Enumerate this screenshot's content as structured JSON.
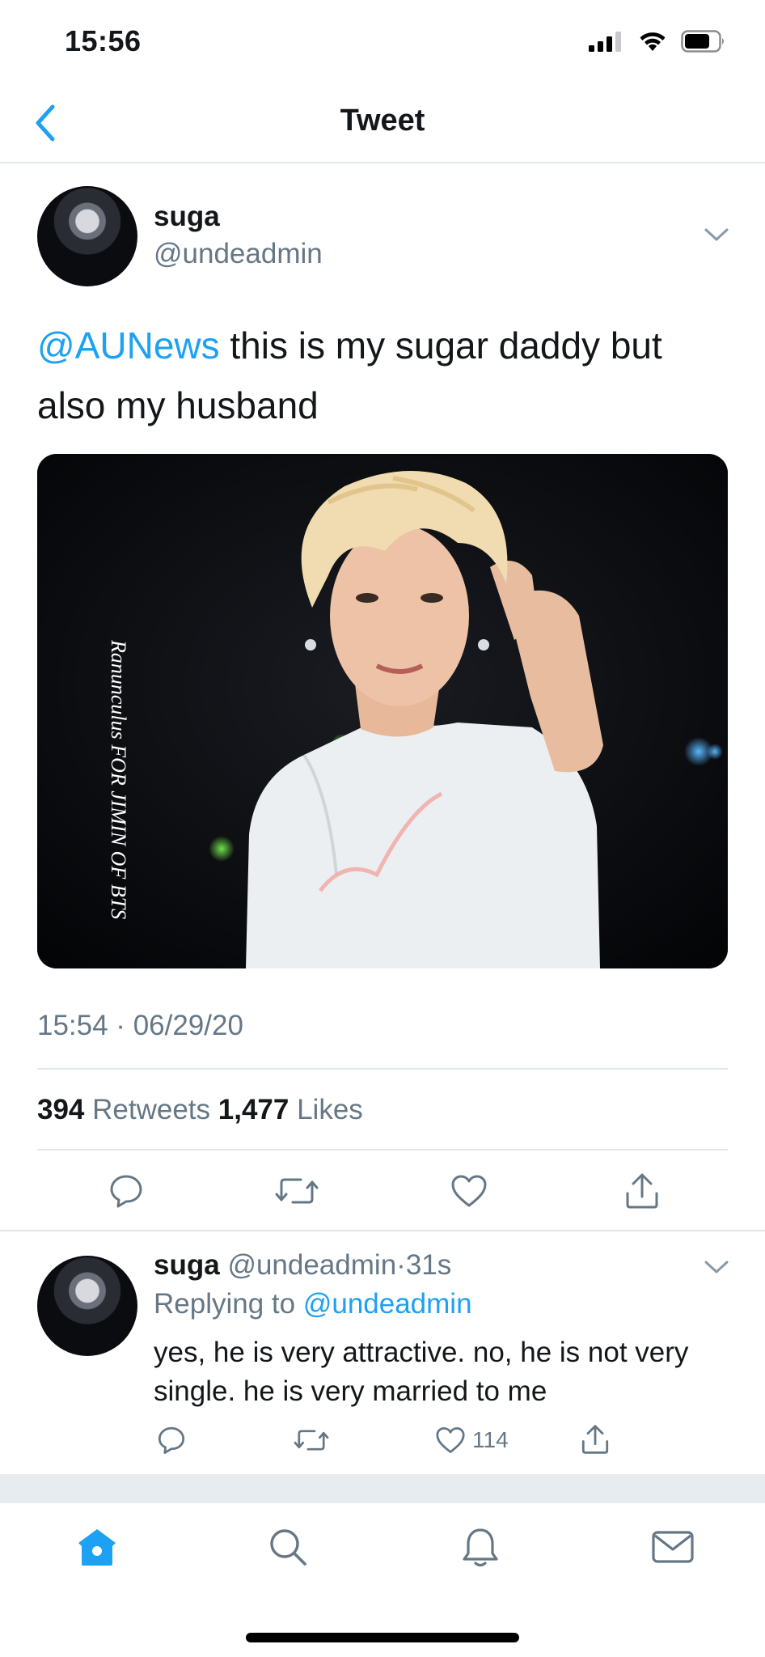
{
  "status_bar": {
    "time": "15:56"
  },
  "nav": {
    "title": "Tweet"
  },
  "tweet": {
    "author_name": "suga",
    "author_handle": "@undeadmin",
    "mention": "@AUNews",
    "text": " this is my sugar daddy but also my husband",
    "image_watermark": "Ranunculus FOR JIMIN OF BTS",
    "timestamp": "15:54 · 06/29/20",
    "retweets_count": "394",
    "retweets_label": " Retweets ",
    "likes_count": "1,477",
    "likes_label": " Likes"
  },
  "reply": {
    "author_name": "suga",
    "author_handle": "@undeadmin",
    "age": "31s",
    "replying_prefix": "Replying to ",
    "replying_to": "@undeadmin",
    "text": "yes, he is very attractive. no, he is not very single. he is very married to me",
    "like_count": "114"
  },
  "colors": {
    "accent": "#1da1f2",
    "secondary_text": "#657786",
    "divider": "#e1e8ed"
  },
  "icons": {
    "action_bar": [
      "reply-icon",
      "retweet-icon",
      "like-icon",
      "share-icon"
    ],
    "tab_bar": [
      "home-icon",
      "search-icon",
      "notifications-icon",
      "messages-icon"
    ]
  }
}
